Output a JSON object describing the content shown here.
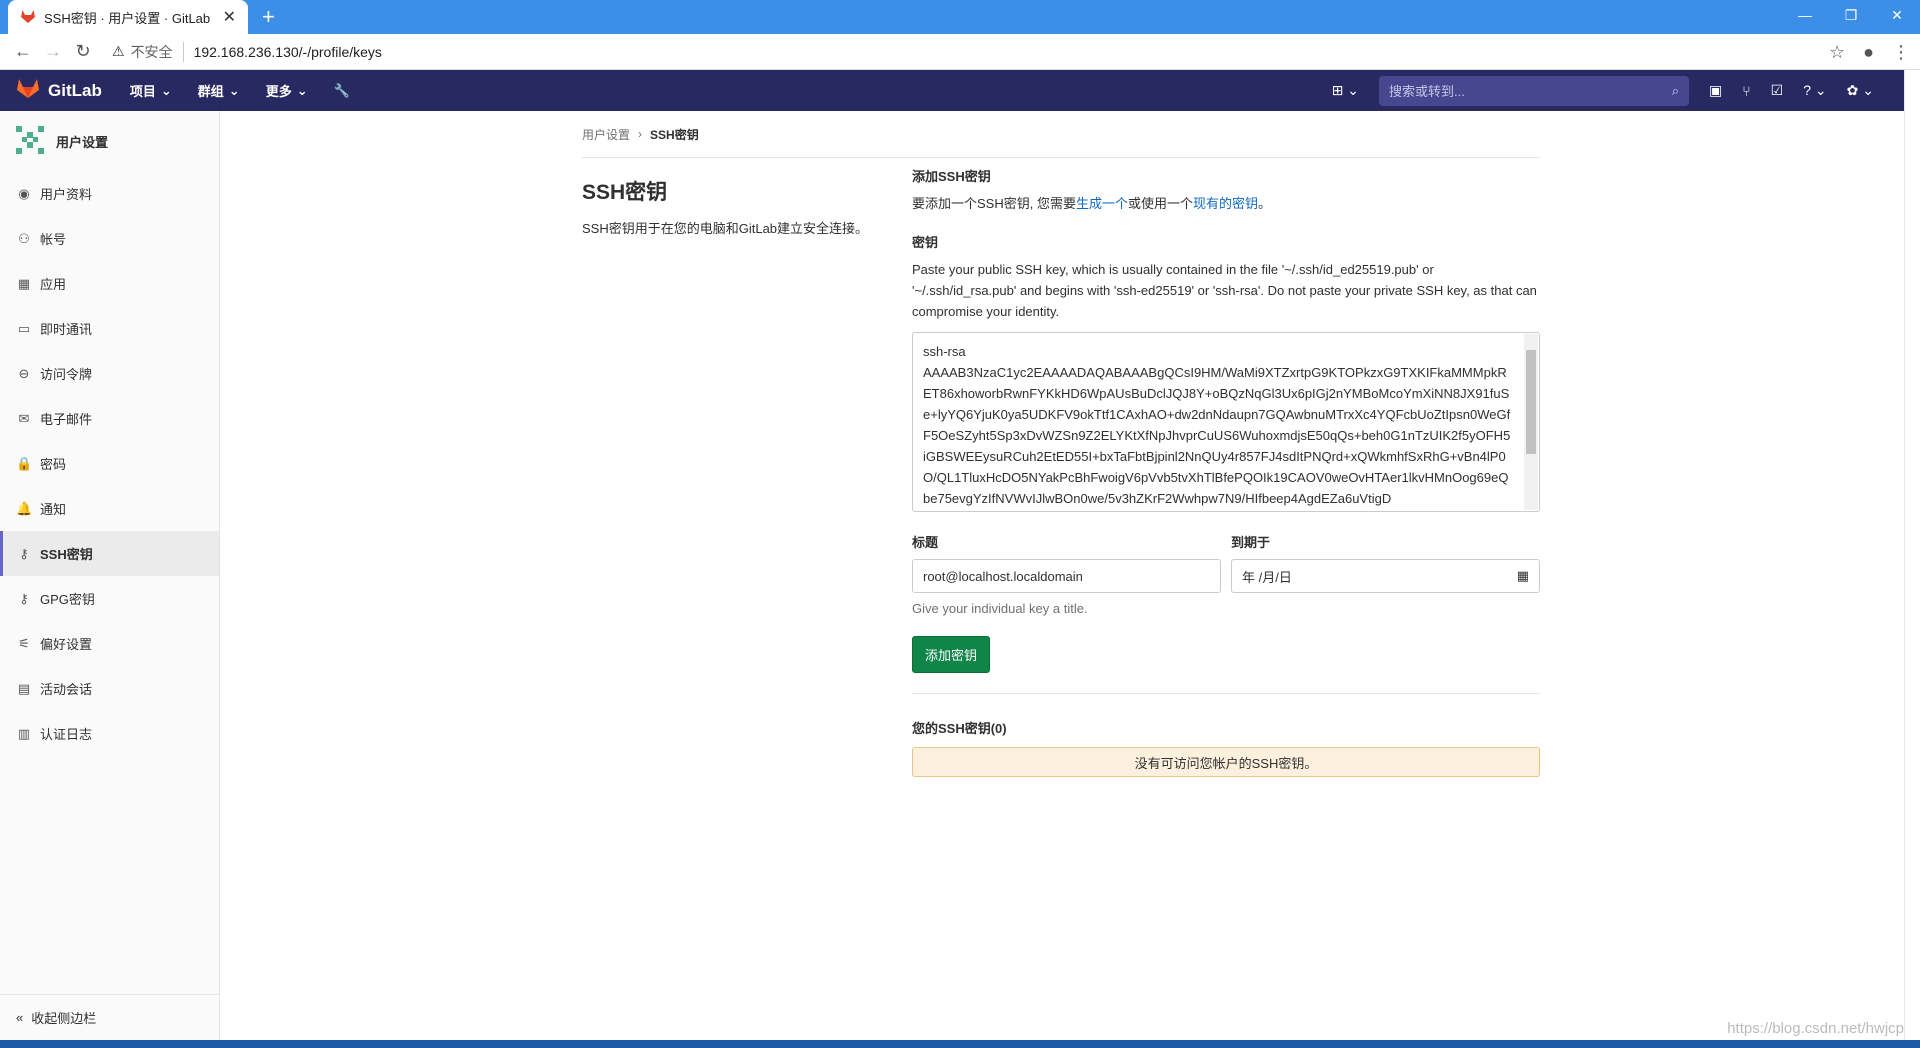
{
  "browser": {
    "tab_title": "SSH密钥 · 用户设置 · GitLab",
    "insecure_label": "不安全",
    "url": "192.168.236.130/-/profile/keys"
  },
  "navbar": {
    "brand": "GitLab",
    "items": [
      {
        "label": "项目"
      },
      {
        "label": "群组"
      },
      {
        "label": "更多"
      }
    ],
    "search_placeholder": "搜索或转到..."
  },
  "sidebar": {
    "title": "用户设置",
    "items": [
      {
        "label": "用户资料",
        "icon": "user-circle-icon"
      },
      {
        "label": "帐号",
        "icon": "account-icon"
      },
      {
        "label": "应用",
        "icon": "applications-icon"
      },
      {
        "label": "即时通讯",
        "icon": "chat-icon"
      },
      {
        "label": "访问令牌",
        "icon": "token-icon"
      },
      {
        "label": "电子邮件",
        "icon": "mail-icon"
      },
      {
        "label": "密码",
        "icon": "lock-icon"
      },
      {
        "label": "通知",
        "icon": "bell-icon"
      },
      {
        "label": "SSH密钥",
        "icon": "key-icon",
        "active": true
      },
      {
        "label": "GPG密钥",
        "icon": "key-icon"
      },
      {
        "label": "偏好设置",
        "icon": "preferences-icon"
      },
      {
        "label": "活动会话",
        "icon": "monitor-icon"
      },
      {
        "label": "认证日志",
        "icon": "log-icon"
      }
    ],
    "collapse_label": "收起侧边栏"
  },
  "breadcrumb": {
    "parent": "用户设置",
    "current": "SSH密钥"
  },
  "left_panel": {
    "title": "SSH密钥",
    "description": "SSH密钥用于在您的电脑和GitLab建立安全连接。"
  },
  "form": {
    "section_title": "添加SSH密钥",
    "intro_prefix": "要添加一个SSH密钥, 您需要",
    "intro_link1": "生成一个",
    "intro_middle": "或使用一个",
    "intro_link2": "现有的密钥",
    "intro_suffix": "。",
    "key_label": "密钥",
    "key_hint": "Paste your public SSH key, which is usually contained in the file '~/.ssh/id_ed25519.pub' or '~/.ssh/id_rsa.pub' and begins with 'ssh-ed25519' or 'ssh-rsa'. Do not paste your private SSH key, as that can compromise your identity.",
    "key_value": "ssh-rsa\nAAAAB3NzaC1yc2EAAAADAQABAAABgQCsI9HM/WaMi9XTZxrtpG9KTOPkzxG9TXKIFkaMMMpkRET86xhoworbRwnFYKkHD6WpAUsBuDclJQJ8Y+oBQzNqGl3Ux6pIGj2nYMBoMcoYmXiNN8JX91fuSe+lyYQ6YjuK0ya5UDKFV9okTtf1CAxhAO+dw2dnNdaupn7GQAwbnuMTrxXc4YQFcbUoZtIpsn0WeGfF5OeSZyht5Sp3xDvWZSn9Z2ELYKtXfNpJhvprCuUS6WuhoxmdjsE50qQs+beh0G1nTzUIK2f5yOFH5iGBSWEEysuRCuh2EtED55I+bxTaFbtBjpinl2NnQUy4r857FJ4sdItPNQrd+xQWkmhfSxRhG+vBn4lP0O/QL1TluxHcDO5NYakPcBhFwoigV6pVvb5tvXhTlBfePQOIk19CAOV0weOvHTAer1lkvHMnOog69eQbe75evgYzIfNVWvIJlwBOn0we/5v3hZKrF2Wwhpw7N9/HIfbeep4AgdEZa6uVtigD",
    "title_label": "标题",
    "title_value": "root@localhost.localdomain",
    "title_hint": "Give your individual key a title.",
    "expires_label": "到期于",
    "expires_placeholder": "年 /月/日",
    "submit_label": "添加密钥",
    "your_keys_title": "您的SSH密钥(0)",
    "empty_message": "没有可访问您帐户的SSH密钥。"
  },
  "watermark": "https://blog.csdn.net/hwjcp",
  "colors": {
    "navbar_bg": "#292961",
    "primary_button": "#108548",
    "link": "#1068bf",
    "alert_bg": "#fdf1dd"
  }
}
